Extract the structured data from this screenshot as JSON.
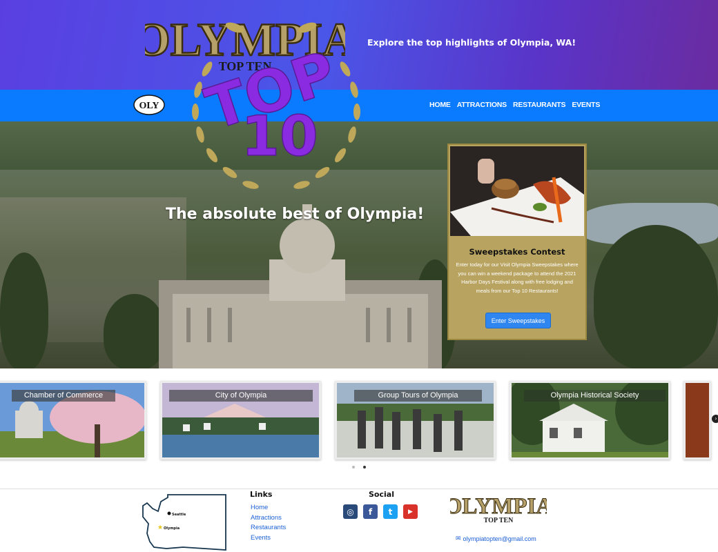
{
  "header": {
    "logo_text": "OLYMPIA",
    "logo_sub": "TOP TEN",
    "tagline": "Explore the top highlights of Olympia, WA!"
  },
  "nav": {
    "logo_text": "OLY",
    "items": [
      {
        "label": "HOME"
      },
      {
        "label": "ATTRACTIONS"
      },
      {
        "label": "RESTAURANTS"
      },
      {
        "label": "EVENTS"
      }
    ]
  },
  "hero": {
    "badge_top": "TOP",
    "badge_num": "10",
    "title": "The absolute best of Olympia!"
  },
  "promo": {
    "title": "Sweepstakes Contest",
    "description": "Enter today for our Visit Olympia Sweepstakes where you can win a weekend package to attend the 2021 Harbor Days Festival along with free lodging and meals from our Top 10 Restaurants!",
    "button": "Enter Sweepstakes"
  },
  "carousel": {
    "prev": "‹",
    "next": "›",
    "cards": [
      {
        "label": "Chamber of Commerce"
      },
      {
        "label": "City of Olympia"
      },
      {
        "label": "Group Tours of Olympia"
      },
      {
        "label": "Olympia Historical Society"
      }
    ]
  },
  "footer": {
    "map_seattle": "Seattle",
    "map_olympia": "Olympia",
    "links_title": "Links",
    "links": [
      {
        "label": "Home"
      },
      {
        "label": "Attractions"
      },
      {
        "label": "Restaurants"
      },
      {
        "label": "Events"
      }
    ],
    "social_title": "Social",
    "social": [
      {
        "name": "instagram-icon",
        "glyph": "◎",
        "color": "#2a4a7a"
      },
      {
        "name": "facebook-icon",
        "glyph": "f",
        "color": "#3b5998"
      },
      {
        "name": "twitter-icon",
        "glyph": "t",
        "color": "#1da1f2"
      },
      {
        "name": "youtube-icon",
        "glyph": "▶",
        "color": "#d9322a"
      }
    ],
    "logo_text": "OLYMPIA",
    "logo_sub": "TOP TEN",
    "email": "olympiatopten@gmail.com"
  },
  "colors": {
    "gold": "#b6a06a",
    "purple": "#8a2be2",
    "nav_blue": "#0a7bff",
    "link_blue": "#1a5fd6"
  }
}
